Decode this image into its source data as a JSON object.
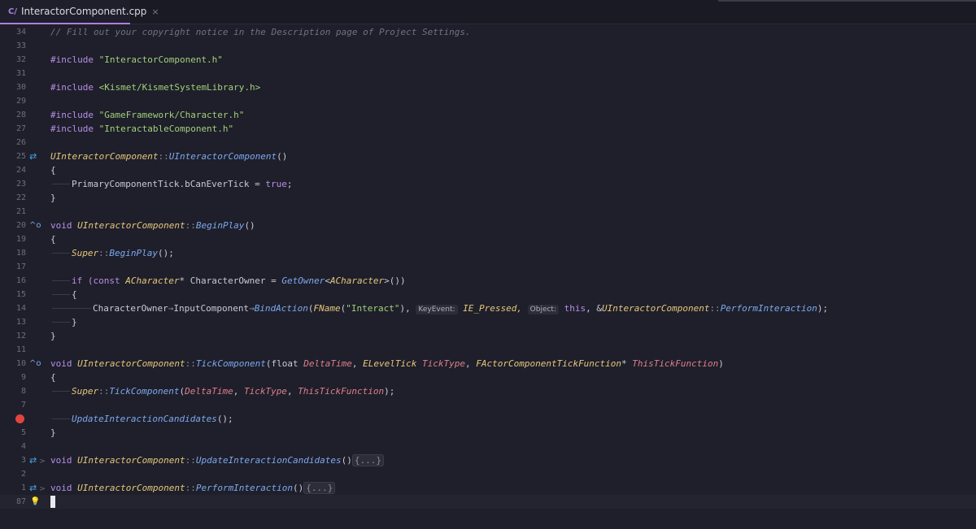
{
  "tab": {
    "icon": "C/",
    "label": "InteractorComponent.cpp",
    "close": "×"
  },
  "lines": {
    "l34": "// Fill out your copyright notice in the Description page of Project Settings.",
    "l32a": "#include ",
    "l32b": "\"InteractorComponent.h\"",
    "l30a": "#include ",
    "l30b": "<Kismet/KismetSystemLibrary.h>",
    "l28a": "#include ",
    "l28b": "\"GameFramework/Character.h\"",
    "l27a": "#include ",
    "l27b": "\"InteractableComponent.h\"",
    "l25a": "UInteractorComponent",
    "l25b": "::",
    "l25c": "UInteractorComponent",
    "l25d": "()",
    "l24": "{",
    "l23a": "PrimaryComponentTick.bCanEverTick = ",
    "l23b": "true",
    "l23c": ";",
    "l22": "}",
    "l20a": "void ",
    "l20b": "UInteractorComponent",
    "l20c": "::",
    "l20d": "BeginPlay",
    "l20e": "()",
    "l19": "{",
    "l18a": "Super",
    "l18b": "::",
    "l18c": "BeginPlay",
    "l18d": "();",
    "l16a": "if (",
    "l16b": "const ",
    "l16c": "ACharacter",
    "l16d": "* CharacterOwner = ",
    "l16e": "GetOwner",
    "l16f": "<",
    "l16g": "ACharacter",
    "l16h": ">())",
    "l15": "{",
    "l14a": "CharacterOwner",
    "l14b": "→",
    "l14c": "InputComponent",
    "l14d": "→",
    "l14e": "BindAction",
    "l14f": "(",
    "l14g": "FName",
    "l14h": "(",
    "l14i": "\"Interact\"",
    "l14j": "), ",
    "l14k": "KeyEvent:",
    "l14l": " IE_Pressed, ",
    "l14m": "Object:",
    "l14n": " this",
    "l14o": ", &",
    "l14p": "UInteractorComponent",
    "l14q": "::",
    "l14r": "PerformInteraction",
    "l14s": ");",
    "l13": "}",
    "l12": "}",
    "l10a": "void ",
    "l10b": "UInteractorComponent",
    "l10c": "::",
    "l10d": "TickComponent",
    "l10e": "(float ",
    "l10f": "DeltaTime",
    "l10g": ", ",
    "l10h": "ELevelTick",
    "l10i": " ",
    "l10j": "TickType",
    "l10k": ", ",
    "l10l": "FActorComponentTickFunction",
    "l10m": "* ",
    "l10n": "ThisTickFunction",
    "l10o": ")",
    "l9": "{",
    "l8a": "Super",
    "l8b": "::",
    "l8c": "TickComponent",
    "l8d": "(",
    "l8e": "DeltaTime",
    "l8f": ", ",
    "l8g": "TickType",
    "l8h": ", ",
    "l8i": "ThisTickFunction",
    "l8j": ");",
    "l6a": "UpdateInteractionCandidates",
    "l6b": "();",
    "l5": "}",
    "l3a": "void ",
    "l3b": "UInteractorComponent",
    "l3c": "::",
    "l3d": "UpdateInteractionCandidates",
    "l3e": "()",
    "l3f": "{...}",
    "l1a": "void ",
    "l1b": "UInteractorComponent",
    "l1c": "::",
    "l1d": "PerformInteraction",
    "l1e": "()",
    "l1f": "{...}"
  },
  "line_numbers": [
    "34",
    "33",
    "32",
    "31",
    "30",
    "29",
    "28",
    "27",
    "26",
    "25",
    "24",
    "23",
    "22",
    "21",
    "20",
    "19",
    "18",
    "17",
    "16",
    "15",
    "14",
    "13",
    "12",
    "11",
    "10",
    "9",
    "8",
    "7",
    "",
    "5",
    "4",
    "3",
    "2",
    "1",
    "87"
  ],
  "gutter": {
    "swap": "⇄",
    "override": "^o",
    "chevron": ">",
    "bulb": "💡"
  }
}
